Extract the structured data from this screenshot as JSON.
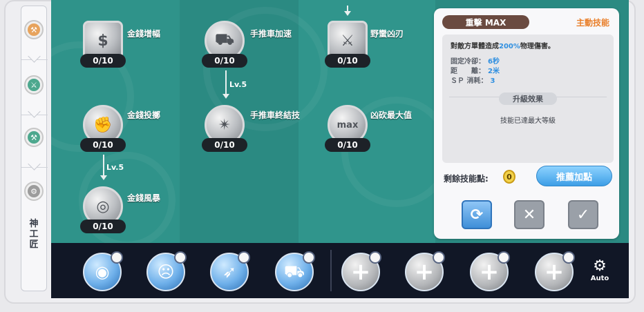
{
  "nav": {
    "items": [
      {
        "icon": "blacksmith-icon",
        "color": "#e7a35c"
      },
      {
        "icon": "axe-icon",
        "color": "#4da88e"
      },
      {
        "icon": "hammer-icon",
        "color": "#4da88e"
      },
      {
        "icon": "cart-icon",
        "color": "#9c9c9c"
      }
    ],
    "class_label": "神工匠"
  },
  "tree": {
    "skills": [
      {
        "name": "金錢增幅",
        "level": "0/10",
        "icon": "money-bag-icon"
      },
      {
        "name": "金錢投擲",
        "level": "0/10",
        "icon": "coin-throw-icon"
      },
      {
        "name": "金錢風暴",
        "level": "0/10",
        "icon": "coin-storm-icon"
      },
      {
        "name": "手推車加速",
        "level": "0/10",
        "icon": "cart-icon"
      },
      {
        "name": "手推車終結技",
        "level": "0/10",
        "icon": "cart-finisher-icon"
      },
      {
        "name": "野蠻凶刃",
        "level": "0/10",
        "icon": "axe-icon"
      },
      {
        "name": "凶砍最大值",
        "level": "0/10",
        "icon": "max-icon"
      }
    ],
    "requirements": [
      "Lv.5",
      "Lv.5"
    ]
  },
  "detail": {
    "title": "重擊 MAX",
    "type": "主動技能",
    "desc_prefix": "對敵方單體造成",
    "desc_highlight": "200%",
    "desc_suffix": "物理傷害。",
    "stats": [
      {
        "label": "固定冷卻：",
        "value": "6秒"
      },
      {
        "label": "距　　離：",
        "value": "2米"
      },
      {
        "label": "ＳＰ 消耗：",
        "value": "3"
      }
    ],
    "upgrade_label": "升級效果",
    "upgrade_text": "技能已達最大等級",
    "points_label": "剩餘技能點:",
    "points_value": "0",
    "recommend_label": "推薦加點",
    "colors": {
      "accent": "#e97f2a",
      "highlight": "#2f8fe0"
    }
  },
  "hotbar": {
    "slots": [
      {
        "icon": "coin-throw-icon"
      },
      {
        "icon": "screaming-face-icon"
      },
      {
        "icon": "dash-icon"
      },
      {
        "icon": "cart-attack-icon"
      },
      {
        "icon": "plus-icon"
      },
      {
        "icon": "plus-icon"
      },
      {
        "icon": "plus-icon"
      },
      {
        "icon": "plus-icon"
      }
    ],
    "auto_label": "Auto"
  }
}
